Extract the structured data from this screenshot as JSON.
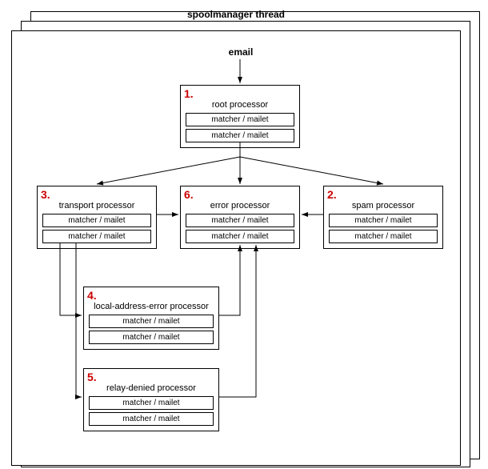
{
  "title": "spoolmanager thread",
  "incoming_label": "email",
  "slot_label": "matcher / mailet",
  "nodes": {
    "root": {
      "num": "1.",
      "title": "root processor"
    },
    "spam": {
      "num": "2.",
      "title": "spam processor"
    },
    "trans": {
      "num": "3.",
      "title": "transport processor"
    },
    "laerr": {
      "num": "4.",
      "title": "local-address-error processor"
    },
    "relay": {
      "num": "5.",
      "title": "relay-denied processor"
    },
    "error": {
      "num": "6.",
      "title": "error processor"
    }
  },
  "chart_data": {
    "type": "diagram",
    "title": "spoolmanager thread",
    "nodes": [
      {
        "id": "email",
        "label": "email",
        "kind": "input"
      },
      {
        "id": "root",
        "num": 1,
        "label": "root processor",
        "slots": [
          "matcher / mailet",
          "matcher / mailet"
        ]
      },
      {
        "id": "spam",
        "num": 2,
        "label": "spam processor",
        "slots": [
          "matcher / mailet",
          "matcher / mailet"
        ]
      },
      {
        "id": "trans",
        "num": 3,
        "label": "transport processor",
        "slots": [
          "matcher / mailet",
          "matcher / mailet"
        ]
      },
      {
        "id": "laerr",
        "num": 4,
        "label": "local-address-error processor",
        "slots": [
          "matcher / mailet",
          "matcher / mailet"
        ]
      },
      {
        "id": "relay",
        "num": 5,
        "label": "relay-denied processor",
        "slots": [
          "matcher / mailet",
          "matcher / mailet"
        ]
      },
      {
        "id": "error",
        "num": 6,
        "label": "error processor",
        "slots": [
          "matcher / mailet",
          "matcher / mailet"
        ]
      }
    ],
    "edges": [
      [
        "email",
        "root"
      ],
      [
        "root",
        "trans"
      ],
      [
        "root",
        "error"
      ],
      [
        "root",
        "spam"
      ],
      [
        "spam",
        "error"
      ],
      [
        "trans",
        "error"
      ],
      [
        "trans",
        "laerr"
      ],
      [
        "trans",
        "relay"
      ],
      [
        "laerr",
        "error"
      ],
      [
        "relay",
        "error"
      ]
    ]
  }
}
